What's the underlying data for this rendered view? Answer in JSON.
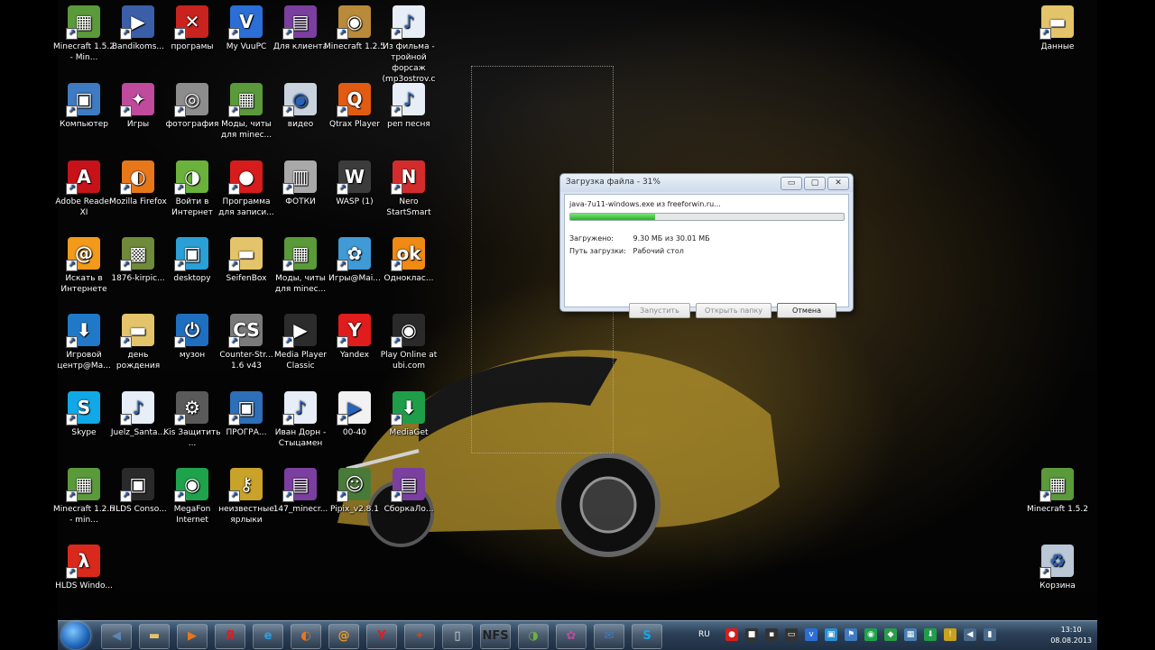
{
  "desktop": {
    "icons": [
      {
        "label": "Minecraft 1.5.2 - Min...",
        "icon": "minecraft-icon",
        "color": "#5a9a3a",
        "glyph": "▦"
      },
      {
        "label": "Bandikoms...",
        "icon": "bandicam-icon",
        "color": "#3a5fa8",
        "glyph": "▶"
      },
      {
        "label": "програмы",
        "icon": "red-x-icon",
        "color": "#c8231e",
        "glyph": "✕"
      },
      {
        "label": "My VuuPC",
        "icon": "vuupc-icon",
        "color": "#2b6fd6",
        "glyph": "V"
      },
      {
        "label": "Для клиента",
        "icon": "winrar-icon",
        "color": "#7b3fa0",
        "glyph": "▤"
      },
      {
        "label": "Minecraft 1.2.5",
        "icon": "package-icon",
        "color": "#b98a3a",
        "glyph": "◉"
      },
      {
        "label": "Из фильма - тройной форсаж (mp3ostrov.c",
        "icon": "mp3-file-icon",
        "color": "#e8eef8",
        "glyph": "♪"
      },
      {
        "label": "Компьютер",
        "icon": "computer-icon",
        "color": "#3f7bc2",
        "glyph": "▣"
      },
      {
        "label": "Игры",
        "icon": "games-icon",
        "color": "#c04a9c",
        "glyph": "✦"
      },
      {
        "label": "фотография",
        "icon": "camera-icon",
        "color": "#8d8d8d",
        "glyph": "◎"
      },
      {
        "label": "Моды, читы для minec...",
        "icon": "minecraft-icon",
        "color": "#5a9a3a",
        "glyph": "▦"
      },
      {
        "label": "видео",
        "icon": "dvd-icon",
        "color": "#c9d3de",
        "glyph": "◉"
      },
      {
        "label": "Qtrax Player",
        "icon": "qtrax-icon",
        "color": "#e25b12",
        "glyph": "Q"
      },
      {
        "label": "реп песня",
        "icon": "mp3-file-icon",
        "color": "#e8eef8",
        "glyph": "♪"
      },
      {
        "label": "Adobe Reader XI",
        "icon": "adobe-reader-icon",
        "color": "#c8121a",
        "glyph": "A"
      },
      {
        "label": "Mozilla Firefox",
        "icon": "firefox-icon",
        "color": "#e8771a",
        "glyph": "◐"
      },
      {
        "label": "Войти в Интернет",
        "icon": "internet-icon",
        "color": "#6ab23c",
        "glyph": "◑"
      },
      {
        "label": "Программа для записи...",
        "icon": "record-icon",
        "color": "#d81c1c",
        "glyph": "●"
      },
      {
        "label": "ФОТКИ",
        "icon": "printer-icon",
        "color": "#a9a9a9",
        "glyph": "▥"
      },
      {
        "label": "WASP (1)",
        "icon": "wasp-icon",
        "color": "#3c3c3c",
        "glyph": "W"
      },
      {
        "label": "Nero StartSmart",
        "icon": "nero-icon",
        "color": "#d42c2c",
        "glyph": "N"
      },
      {
        "label": "Искать в Интернете",
        "icon": "search-mail-icon",
        "color": "#f39a1a",
        "glyph": "@"
      },
      {
        "label": "1876-kirpic...",
        "icon": "image-file-icon",
        "color": "#6f8a3a",
        "glyph": "▩"
      },
      {
        "label": "desktopy",
        "icon": "desktop-shortcut-icon",
        "color": "#2aa0d6",
        "glyph": "▣"
      },
      {
        "label": "SeifenBox",
        "icon": "folder-icon",
        "color": "#e4c46a",
        "glyph": "▬"
      },
      {
        "label": "Моды, читы для minec...",
        "icon": "minecraft-icon",
        "color": "#5a9a3a",
        "glyph": "▦"
      },
      {
        "label": "Игры@Mai...",
        "icon": "mail-games-icon",
        "color": "#3f9ad6",
        "glyph": "✿"
      },
      {
        "label": "Одноклас...",
        "icon": "odnoklassniki-icon",
        "color": "#f08a14",
        "glyph": "ok"
      },
      {
        "label": "Игровой центр@Ma...",
        "icon": "download-icon",
        "color": "#1f79c8",
        "glyph": "⬇"
      },
      {
        "label": "день рождения",
        "icon": "folder-icon",
        "color": "#e4c46a",
        "glyph": "▬"
      },
      {
        "label": "музон",
        "icon": "power-icon",
        "color": "#1f6fc0",
        "glyph": "⏻"
      },
      {
        "label": "Counter-Str... 1.6 v43",
        "icon": "counter-strike-icon",
        "color": "#7a7a7a",
        "glyph": "CS"
      },
      {
        "label": "Media Player Classic",
        "icon": "media-player-icon",
        "color": "#2c2c2c",
        "glyph": "▶"
      },
      {
        "label": "Yandex",
        "icon": "yandex-icon",
        "color": "#e11c1c",
        "glyph": "Y"
      },
      {
        "label": "Play Online at ubi.com",
        "icon": "ubi-icon",
        "color": "#2a2a2a",
        "glyph": "◉"
      },
      {
        "label": "Skype",
        "icon": "skype-icon",
        "color": "#11a8e8",
        "glyph": "S"
      },
      {
        "label": "Juelz_Santa...",
        "icon": "mp3-file-icon",
        "color": "#e8eef8",
        "glyph": "♪"
      },
      {
        "label": "Kis Защитить ...",
        "icon": "gear-icon",
        "color": "#5a5a5a",
        "glyph": "⚙"
      },
      {
        "label": "ПРОГРА...",
        "icon": "network-icon",
        "color": "#2d6fb8",
        "glyph": "▣"
      },
      {
        "label": "Иван Дорн - Стыцамен",
        "icon": "mp3-file-icon",
        "color": "#e8eef8",
        "glyph": "♪"
      },
      {
        "label": "00-40",
        "icon": "video-file-icon",
        "color": "#f2f2f2",
        "glyph": "▶"
      },
      {
        "label": "MediaGet",
        "icon": "mediaget-icon",
        "color": "#1f9e4a",
        "glyph": "⬇"
      },
      {
        "label": "Minecraft 1.2.5 - min...",
        "icon": "minecraft-icon",
        "color": "#5a9a3a",
        "glyph": "▦"
      },
      {
        "label": "HLDS Conso...",
        "icon": "lock-icon",
        "color": "#2a2a2a",
        "glyph": "▣"
      },
      {
        "label": "MegaFon Internet",
        "icon": "megafon-icon",
        "color": "#1ea34c",
        "glyph": "◉"
      },
      {
        "label": "неизвестные ярлыки",
        "icon": "keys-icon",
        "color": "#c9a22a",
        "glyph": "⚷"
      },
      {
        "label": "147_minecr...",
        "icon": "winrar-icon",
        "color": "#7b3fa0",
        "glyph": "▤"
      },
      {
        "label": "Pipix_v2.8.1",
        "icon": "pipix-icon",
        "color": "#4a7a3a",
        "glyph": "☺"
      },
      {
        "label": "СборкаЛо...",
        "icon": "winrar-icon",
        "color": "#7b3fa0",
        "glyph": "▤"
      },
      {
        "label": "HLDS Windo...",
        "icon": "half-life-icon",
        "color": "#d8291c",
        "glyph": "λ"
      }
    ],
    "right_icons": [
      {
        "label": "Данные",
        "icon": "folder-icon",
        "color": "#e4c46a",
        "glyph": "▬"
      },
      {
        "label": "Minecraft 1.5.2",
        "icon": "minecraft-icon",
        "color": "#5a9a3a",
        "glyph": "▦"
      },
      {
        "label": "Корзина",
        "icon": "recycle-bin-icon",
        "color": "#b9c7d6",
        "glyph": "♻"
      }
    ]
  },
  "dialog": {
    "title": "Загрузка файла - 31%",
    "file": "java-7u11-windows.exe из freeforwin.ru...",
    "progress_percent": 31,
    "downloaded_label": "Загружено:",
    "downloaded_value": "9.30 МБ из 30.01 МБ",
    "path_label": "Путь загрузки:",
    "path_value": "Рабочий стол",
    "buttons": {
      "run": "Запустить",
      "open_folder": "Открыть папку",
      "cancel": "Отмена"
    },
    "window_buttons": {
      "minimize": "▭",
      "maximize": "▢",
      "close": "✕"
    }
  },
  "taskbar": {
    "pinned": [
      {
        "icon": "speaker-icon",
        "glyph": "◀",
        "color": "#5b86b5"
      },
      {
        "icon": "folder-icon",
        "glyph": "▬",
        "color": "#e4c46a"
      },
      {
        "icon": "media-player-icon",
        "glyph": "▶",
        "color": "#e8771a"
      },
      {
        "icon": "yandex-icon",
        "glyph": "Я",
        "color": "#e11c1c"
      },
      {
        "icon": "ie-icon",
        "glyph": "e",
        "color": "#2aa0e8"
      },
      {
        "icon": "firefox-icon",
        "glyph": "◐",
        "color": "#e8771a"
      },
      {
        "icon": "mail-icon",
        "glyph": "@",
        "color": "#f39a1a"
      },
      {
        "icon": "yandex-browser-icon",
        "glyph": "Y",
        "color": "#e11c1c"
      },
      {
        "icon": "game-icon",
        "glyph": "✦",
        "color": "#c04a2a"
      },
      {
        "icon": "document-icon",
        "glyph": "▯",
        "color": "#ffffff"
      },
      {
        "icon": "nfs-icon",
        "glyph": "NFS",
        "color": "#222222"
      },
      {
        "icon": "internet-icon",
        "glyph": "◑",
        "color": "#6ab23c"
      },
      {
        "icon": "games-icon",
        "glyph": "✿",
        "color": "#c04a9c"
      },
      {
        "icon": "mail-icon",
        "glyph": "✉",
        "color": "#3f7bc2"
      },
      {
        "icon": "skype-icon",
        "glyph": "S",
        "color": "#11a8e8"
      }
    ],
    "language": "RU",
    "tray": [
      {
        "icon": "record-icon",
        "glyph": "●",
        "color": "#d81c1c"
      },
      {
        "icon": "stop-icon",
        "glyph": "■",
        "color": "#333333"
      },
      {
        "icon": "camera-icon",
        "glyph": "▪",
        "color": "#333333"
      },
      {
        "icon": "screen-icon",
        "glyph": "▭",
        "color": "#333333"
      },
      {
        "icon": "vuupc-icon",
        "glyph": "v",
        "color": "#2b6fd6"
      },
      {
        "icon": "network-icon",
        "glyph": "▣",
        "color": "#2d8fd6"
      },
      {
        "icon": "flag-icon",
        "glyph": "⚑",
        "color": "#3f7bc2"
      },
      {
        "icon": "megafon-icon",
        "glyph": "◉",
        "color": "#1ea34c"
      },
      {
        "icon": "shield-icon",
        "glyph": "◆",
        "color": "#2a9d4a"
      },
      {
        "icon": "network-icon",
        "glyph": "▦",
        "color": "#4a7fb0"
      },
      {
        "icon": "download-icon",
        "glyph": "⬇",
        "color": "#1f9e4a"
      },
      {
        "icon": "warning-icon",
        "glyph": "!",
        "color": "#c8a21a"
      },
      {
        "icon": "volume-icon",
        "glyph": "◀",
        "color": "#4a6a8a"
      },
      {
        "icon": "signal-icon",
        "glyph": "▮",
        "color": "#4a6a8a"
      }
    ],
    "time": "13:10",
    "date": "08.08.2013"
  }
}
